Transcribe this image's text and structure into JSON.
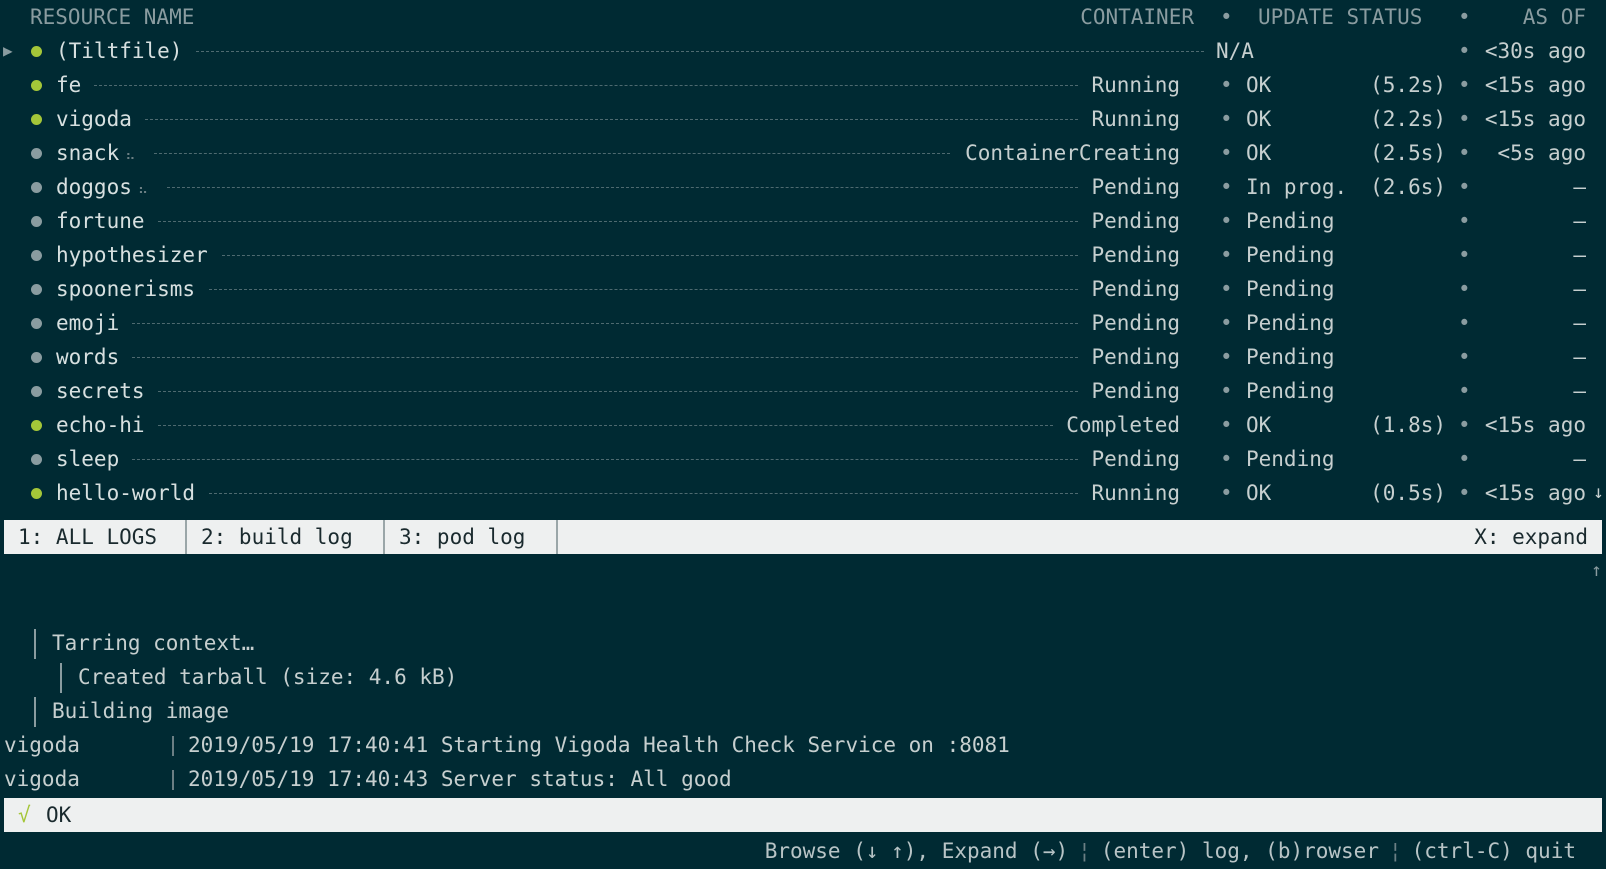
{
  "header": {
    "resource_name": "RESOURCE NAME",
    "container": "CONTAINER",
    "update_status": "UPDATE STATUS",
    "as_of": "AS OF",
    "separator": "•"
  },
  "resources": [
    {
      "name": "(Tiltfile)",
      "status": "",
      "update": "N/A",
      "duration": "",
      "as_of": "<30s ago",
      "dot": "green",
      "spinner": false,
      "arrow": true
    },
    {
      "name": "fe",
      "status": "Running",
      "update": "OK",
      "duration": "(5.2s)",
      "as_of": "<15s ago",
      "dot": "green",
      "spinner": false
    },
    {
      "name": "vigoda",
      "status": "Running",
      "update": "OK",
      "duration": "(2.2s)",
      "as_of": "<15s ago",
      "dot": "green",
      "spinner": false
    },
    {
      "name": "snack",
      "status": "ContainerCreating",
      "update": "OK",
      "duration": "(2.5s)",
      "as_of": "<5s ago",
      "dot": "gray",
      "spinner": true
    },
    {
      "name": "doggos",
      "status": "Pending",
      "update": "In prog.",
      "duration": "(2.6s)",
      "as_of": "–",
      "dot": "gray",
      "spinner": true
    },
    {
      "name": "fortune",
      "status": "Pending",
      "update": "Pending",
      "duration": "",
      "as_of": "–",
      "dot": "gray",
      "spinner": false
    },
    {
      "name": "hypothesizer",
      "status": "Pending",
      "update": "Pending",
      "duration": "",
      "as_of": "–",
      "dot": "gray",
      "spinner": false
    },
    {
      "name": "spoonerisms",
      "status": "Pending",
      "update": "Pending",
      "duration": "",
      "as_of": "–",
      "dot": "gray",
      "spinner": false
    },
    {
      "name": "emoji",
      "status": "Pending",
      "update": "Pending",
      "duration": "",
      "as_of": "–",
      "dot": "gray",
      "spinner": false
    },
    {
      "name": "words",
      "status": "Pending",
      "update": "Pending",
      "duration": "",
      "as_of": "–",
      "dot": "gray",
      "spinner": false
    },
    {
      "name": "secrets",
      "status": "Pending",
      "update": "Pending",
      "duration": "",
      "as_of": "–",
      "dot": "gray",
      "spinner": false
    },
    {
      "name": "echo-hi",
      "status": "Completed",
      "update": "OK",
      "duration": "(1.8s)",
      "as_of": "<15s ago",
      "dot": "green",
      "spinner": false
    },
    {
      "name": "sleep",
      "status": "Pending",
      "update": "Pending",
      "duration": "",
      "as_of": "–",
      "dot": "gray",
      "spinner": false
    },
    {
      "name": "hello-world",
      "status": "Running",
      "update": "OK",
      "duration": "(0.5s)",
      "as_of": "<15s ago",
      "dot": "green",
      "spinner": false
    }
  ],
  "tabs": [
    {
      "label": "1: ALL LOGS"
    },
    {
      "label": "2: build log"
    },
    {
      "label": "3: pod log"
    }
  ],
  "expand_label": "X: expand",
  "log_lines": [
    {
      "indent": 1,
      "text": "Tarring context…"
    },
    {
      "indent": 2,
      "text": "Created tarball (size: 4.6 kB)"
    },
    {
      "indent": 1,
      "text": "Building image"
    }
  ],
  "pod_logs": [
    {
      "source": "vigoda",
      "text": "2019/05/19 17:40:41 Starting Vigoda Health Check Service on :8081"
    },
    {
      "source": "vigoda",
      "text": "2019/05/19 17:40:43 Server status: All good"
    }
  ],
  "status_bar": {
    "check": "√",
    "text": "OK"
  },
  "footer": {
    "browse": "Browse (↓ ↑), Expand (→)",
    "log": "(enter) log, (b)rowser",
    "quit": "(ctrl-C) quit",
    "separator": "¦"
  },
  "icons": {
    "expand_arrow": "▶",
    "scroll_down": "↓",
    "scroll_up": "↑",
    "spinner": "⠦"
  },
  "colors": {
    "background": "#002a33",
    "ok_dot": "#a4c639",
    "pending_dot": "#8a9ca0",
    "bar_background": "#eef0f0"
  }
}
